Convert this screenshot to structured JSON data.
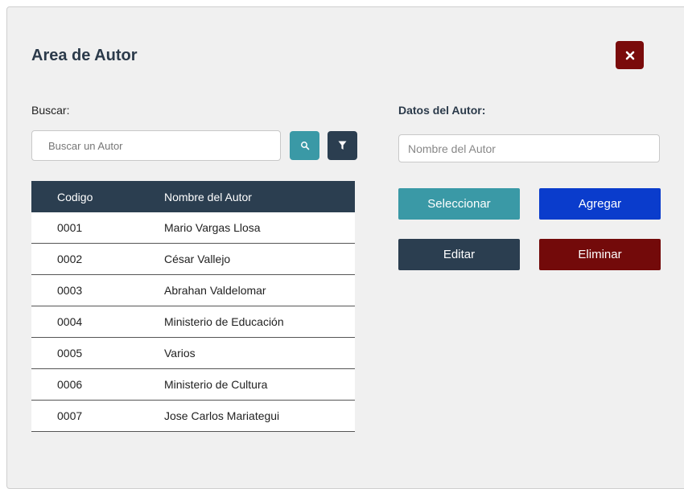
{
  "header": {
    "title": "Area de Autor"
  },
  "search": {
    "label": "Buscar:",
    "placeholder": "Buscar un Autor"
  },
  "table": {
    "columns": [
      "Codigo",
      "Nombre del Autor"
    ],
    "rows": [
      {
        "code": "0001",
        "name": "Mario Vargas Llosa"
      },
      {
        "code": "0002",
        "name": "César Vallejo"
      },
      {
        "code": "0003",
        "name": "Abrahan Valdelomar"
      },
      {
        "code": "0004",
        "name": "Ministerio de Educación"
      },
      {
        "code": "0005",
        "name": "Varios"
      },
      {
        "code": "0006",
        "name": "Ministerio de Cultura"
      },
      {
        "code": "0007",
        "name": "Jose Carlos Mariategui"
      }
    ]
  },
  "details": {
    "label": "Datos del Autor:",
    "name_placeholder": "Nombre del Autor"
  },
  "actions": {
    "select": "Seleccionar",
    "add": "Agregar",
    "edit": "Editar",
    "delete": "Eliminar"
  },
  "icons": {
    "close": "close-icon",
    "search": "search-icon",
    "filter": "filter-icon"
  },
  "colors": {
    "teal": "#3a99a6",
    "navy": "#2b3e50",
    "blue": "#0a3ccc",
    "dark_red": "#730a0a"
  }
}
